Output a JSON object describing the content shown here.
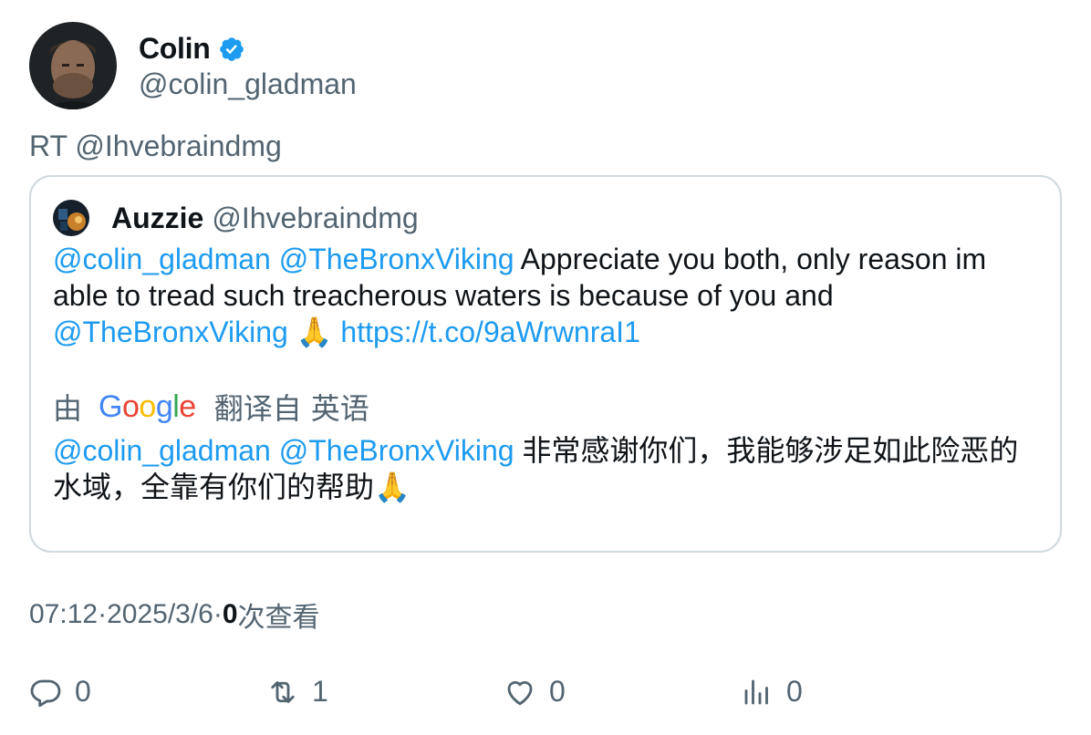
{
  "author": {
    "display_name": "Colin",
    "handle": "@colin_gladman"
  },
  "retweet_line": "RT @Ihvebraindmg",
  "quote": {
    "display_name": "Auzzie",
    "handle": "@Ihvebraindmg",
    "mention1": "@colin_gladman",
    "mention2": "@TheBronxViking",
    "text1": " Appreciate you both, only reason im able to tread such treacherous waters is because of you and ",
    "mention3": "@TheBronxViking",
    "emoji": " 🙏 ",
    "link": "https://t.co/9aWrwnraI1",
    "translate_prefix": "由",
    "translate_suffix": "翻译自",
    "translate_lang": "英语",
    "tr_mention1": "@colin_gladman",
    "tr_mention2": "@TheBronxViking",
    "tr_text": " 非常感谢你们，我能够涉足如此险恶的水域，全靠有你们的帮助🙏"
  },
  "meta": {
    "time": "07:12",
    "sep1": " · ",
    "date": "2025/3/6",
    "sep2": " · ",
    "views_count": "0",
    "views_label": "次查看"
  },
  "actions": {
    "reply": "0",
    "retweet": "1",
    "like": "0",
    "views": "0"
  },
  "colors": {
    "link": "#1d9bf0",
    "secondary": "#536471",
    "border": "#cfd9de"
  }
}
